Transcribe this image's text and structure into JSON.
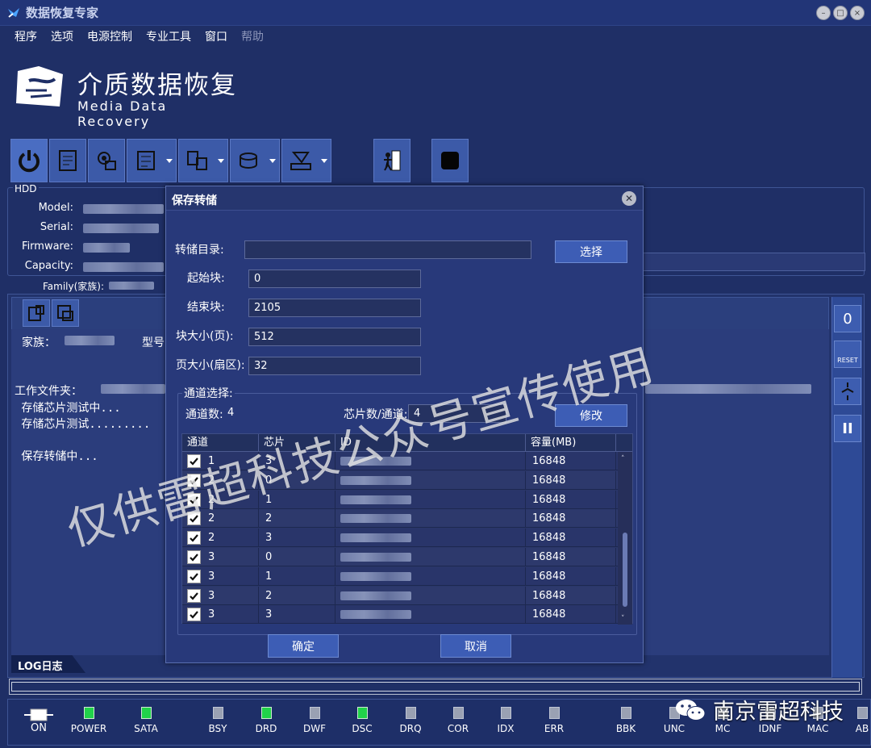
{
  "window": {
    "title": "数据恢复专家"
  },
  "menu": [
    {
      "label": "程序",
      "enabled": true
    },
    {
      "label": "选项",
      "enabled": true
    },
    {
      "label": "电源控制",
      "enabled": true
    },
    {
      "label": "专业工具",
      "enabled": true
    },
    {
      "label": "窗口",
      "enabled": true
    },
    {
      "label": "帮助",
      "enabled": false
    }
  ],
  "logo": {
    "cn": "介质数据恢复",
    "en": "Media Data Recovery"
  },
  "toolbar": {
    "buttons": [
      "power-icon",
      "document-icon",
      "gear-chip-icon",
      "circuit-icon",
      "chips-icon",
      "disk-icon",
      "tool-icon",
      "exit-icon",
      "stop-icon"
    ]
  },
  "hdd": {
    "group_label": "HDD",
    "fields": [
      "Model:",
      "Serial:",
      "Firmware:",
      "Capacity:"
    ],
    "family_label": "Family(家族):"
  },
  "log": {
    "lines": [
      "家族：",
      "工作文件夹：",
      " 存储芯片测试中...",
      " 存储芯片测试.........",
      " 保存转储中..."
    ],
    "model_label": "型号",
    "tab": "LOG日志"
  },
  "right_tools": [
    "0",
    "RESET",
    "",
    "II"
  ],
  "dialog": {
    "title": "保存转储",
    "dump_dir_label": "转储目录:",
    "dump_dir_value": "",
    "choose_button": "选择",
    "start_label": "起始块:",
    "start_value": "0",
    "end_label": "结束块:",
    "end_value": "2105",
    "block_size_label": "块大小(页):",
    "block_size_value": "512",
    "page_size_label": "页大小(扇区):",
    "page_size_value": "32",
    "channel_group": "通道选择:",
    "channel_count_label": "通道数:",
    "channel_count_value": "4",
    "chips_per_channel_label": "芯片数/通道:",
    "chips_per_channel_value": "4",
    "modify_button": "修改",
    "columns": [
      "通道",
      "芯片",
      "ID",
      "容量(MB)"
    ],
    "rows": [
      {
        "channel": "1",
        "chip": "3",
        "capacity": "16848",
        "checked": true
      },
      {
        "channel": "2",
        "chip": "0",
        "capacity": "16848",
        "checked": true
      },
      {
        "channel": "2",
        "chip": "1",
        "capacity": "16848",
        "checked": true
      },
      {
        "channel": "2",
        "chip": "2",
        "capacity": "16848",
        "checked": true
      },
      {
        "channel": "2",
        "chip": "3",
        "capacity": "16848",
        "checked": true
      },
      {
        "channel": "3",
        "chip": "0",
        "capacity": "16848",
        "checked": true
      },
      {
        "channel": "3",
        "chip": "1",
        "capacity": "16848",
        "checked": true
      },
      {
        "channel": "3",
        "chip": "2",
        "capacity": "16848",
        "checked": true
      },
      {
        "channel": "3",
        "chip": "3",
        "capacity": "16848",
        "checked": true
      }
    ],
    "ok_button": "确定",
    "cancel_button": "取消"
  },
  "status": {
    "on_label": "ON",
    "leds": [
      {
        "label": "POWER",
        "on": true
      },
      {
        "label": "SATA",
        "on": true
      },
      {
        "label": "BSY",
        "on": false
      },
      {
        "label": "DRD",
        "on": true
      },
      {
        "label": "DWF",
        "on": false
      },
      {
        "label": "DSC",
        "on": true
      },
      {
        "label": "DRQ",
        "on": false
      },
      {
        "label": "COR",
        "on": false
      },
      {
        "label": "IDX",
        "on": false
      },
      {
        "label": "ERR",
        "on": false
      },
      {
        "label": "BBK",
        "on": false
      },
      {
        "label": "UNC",
        "on": false
      },
      {
        "label": "MC",
        "on": false
      },
      {
        "label": "IDNF",
        "on": false
      },
      {
        "label": "MAC",
        "on": false
      },
      {
        "label": "AB",
        "on": false
      }
    ]
  },
  "watermark": "仅供雷超科技公众号宣传使用",
  "brand": "南京雷超科技",
  "colors": {
    "background": "#1f2f66",
    "led_on": "#21d24a",
    "button": "#3d5db5"
  }
}
